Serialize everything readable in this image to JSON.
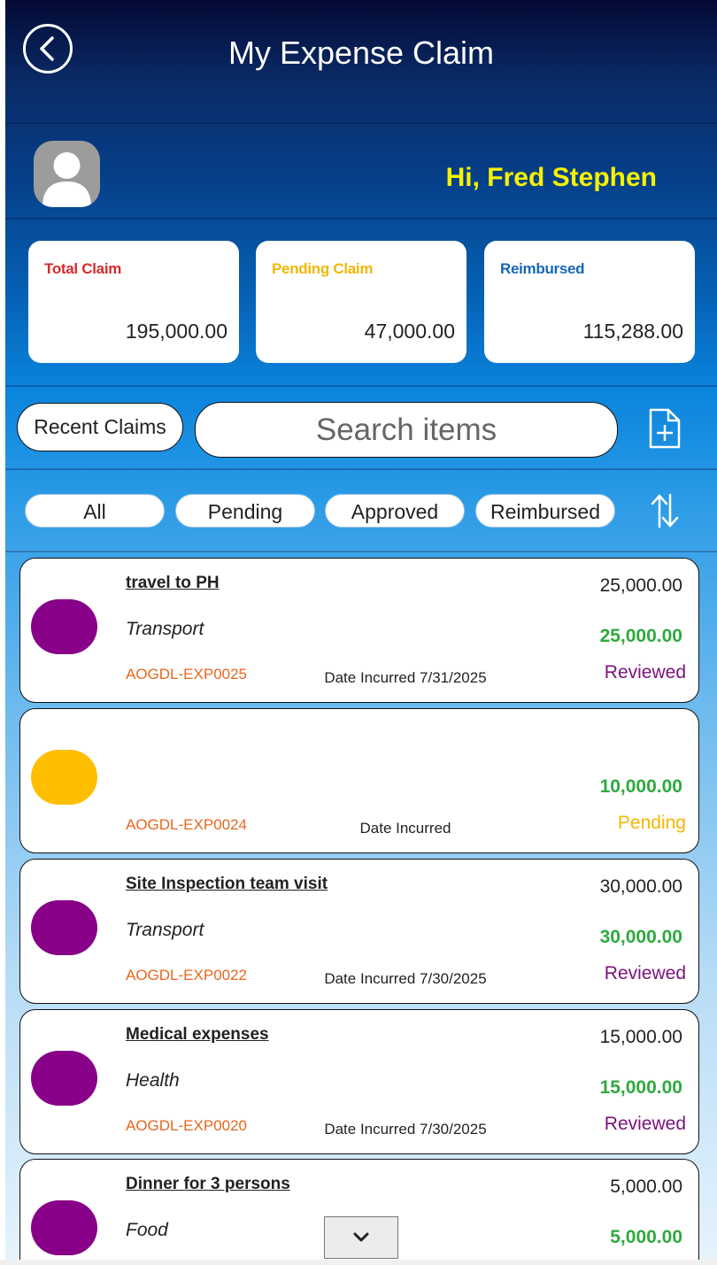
{
  "header": {
    "title": "My Expense Claim",
    "greeting": "Hi, Fred Stephen"
  },
  "summary": {
    "total": {
      "label": "Total Claim",
      "value": "195,000.00",
      "color": "#d52b2b"
    },
    "pending": {
      "label": "Pending Claim",
      "value": "47,000.00",
      "color": "#f2b705"
    },
    "reimbursed": {
      "label": "Reimbursed",
      "value": "115,288.00",
      "color": "#1766b3"
    }
  },
  "toolbar": {
    "recent_label": "Recent Claims",
    "search_placeholder": "Search items"
  },
  "filters": [
    "All",
    "Pending",
    "Approved",
    "Reimbursed"
  ],
  "claims": [
    {
      "name": "travel to PH",
      "category": "Transport",
      "code": "AOGDL-EXP0025",
      "date": "Date Incurred 7/31/2025",
      "amount": "25,000.00",
      "approved": "25,000.00",
      "status": "Reviewed",
      "status_color": "#7b127b",
      "dot_color": "#870087"
    },
    {
      "name": "",
      "category": "",
      "code": "AOGDL-EXP0024",
      "date": "Date Incurred",
      "amount": "",
      "approved": "10,000.00",
      "status": "Pending",
      "status_color": "#f4b600",
      "dot_color": "#ffbf00"
    },
    {
      "name": "Site Inspection team visit",
      "category": "Transport",
      "code": "AOGDL-EXP0022",
      "date": "Date Incurred 7/30/2025",
      "amount": "30,000.00",
      "approved": "30,000.00",
      "status": "Reviewed",
      "status_color": "#7b127b",
      "dot_color": "#870087"
    },
    {
      "name": "Medical expenses",
      "category": "Health",
      "code": "AOGDL-EXP0020",
      "date": "Date Incurred 7/30/2025",
      "amount": "15,000.00",
      "approved": "15,000.00",
      "status": "Reviewed",
      "status_color": "#7b127b",
      "dot_color": "#870087"
    },
    {
      "name": "Dinner for 3 persons",
      "category": "Food",
      "code": "",
      "date": "",
      "amount": "5,000.00",
      "approved": "5,000.00",
      "status": "",
      "status_color": "#7b127b",
      "dot_color": "#870087"
    }
  ],
  "icons": {
    "back": "back-arrow-icon",
    "user": "user-icon",
    "add": "add-file-icon",
    "sort": "sort-icon",
    "scroll": "chevron-down-icon"
  }
}
